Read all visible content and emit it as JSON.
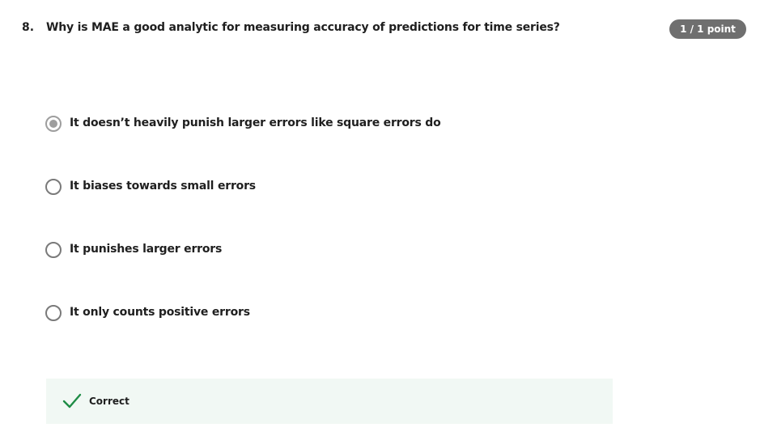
{
  "question": {
    "number": "8.",
    "text": "Why is MAE a good analytic for measuring accuracy of predictions for time series?",
    "score": "1 / 1 point"
  },
  "options": [
    {
      "label": "It doesn’t heavily punish larger errors like square errors do",
      "selected": true
    },
    {
      "label": "It biases towards small errors",
      "selected": false
    },
    {
      "label": "It punishes larger errors",
      "selected": false
    },
    {
      "label": "It only counts positive errors",
      "selected": false
    }
  ],
  "feedback": {
    "label": "Correct",
    "icon": "check-icon",
    "color": "#1e8c45"
  }
}
